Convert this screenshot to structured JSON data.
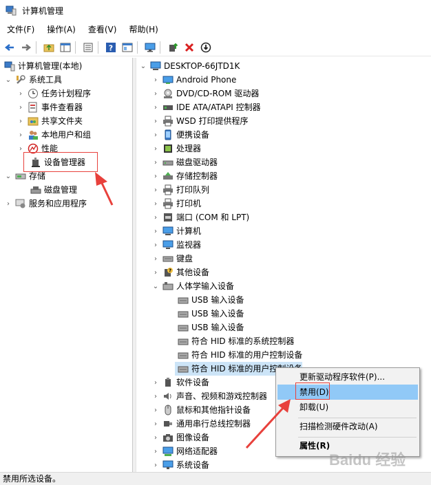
{
  "window": {
    "title": "计算机管理"
  },
  "menubar": [
    "文件(F)",
    "操作(A)",
    "查看(V)",
    "帮助(H)"
  ],
  "toolbar": {
    "icons": [
      "back-arrow-icon",
      "forward-arrow-icon",
      "up-folder-icon",
      "show-hide-tree-icon",
      "export-list-icon",
      "help-icon",
      "properties-icon",
      "monitor-icon",
      "update-driver-icon",
      "uninstall-icon",
      "disable-icon"
    ]
  },
  "left_tree": [
    {
      "label": "计算机管理(本地)"
    },
    {
      "label": "系统工具"
    },
    {
      "label": "任务计划程序"
    },
    {
      "label": "事件查看器"
    },
    {
      "label": "共享文件夹"
    },
    {
      "label": "本地用户和组"
    },
    {
      "label": "性能"
    },
    {
      "label": "设备管理器"
    },
    {
      "label": "存储"
    },
    {
      "label": "磁盘管理"
    },
    {
      "label": "服务和应用程序"
    }
  ],
  "right_tree": [
    {
      "label": "DESKTOP-66JTD1K"
    },
    {
      "label": "Android Phone"
    },
    {
      "label": "DVD/CD-ROM 驱动器"
    },
    {
      "label": "IDE ATA/ATAPI 控制器"
    },
    {
      "label": "WSD 打印提供程序"
    },
    {
      "label": "便携设备"
    },
    {
      "label": "处理器"
    },
    {
      "label": "磁盘驱动器"
    },
    {
      "label": "存储控制器"
    },
    {
      "label": "打印队列"
    },
    {
      "label": "打印机"
    },
    {
      "label": "端口 (COM 和 LPT)"
    },
    {
      "label": "计算机"
    },
    {
      "label": "监视器"
    },
    {
      "label": "键盘"
    },
    {
      "label": "其他设备"
    },
    {
      "label": "人体学输入设备"
    },
    {
      "label": "USB 输入设备"
    },
    {
      "label": "USB 输入设备"
    },
    {
      "label": "USB 输入设备"
    },
    {
      "label": "符合 HID 标准的系统控制器"
    },
    {
      "label": "符合 HID 标准的用户控制设备"
    },
    {
      "label": "符合 HID 标准的用户控制设备"
    },
    {
      "label": "软件设备"
    },
    {
      "label": "声音、视频和游戏控制器"
    },
    {
      "label": "鼠标和其他指针设备"
    },
    {
      "label": "通用串行总线控制器"
    },
    {
      "label": "图像设备"
    },
    {
      "label": "网络适配器"
    },
    {
      "label": "系统设备"
    }
  ],
  "context_menu": {
    "items": [
      "更新驱动程序软件(P)...",
      "禁用(D)",
      "卸载(U)",
      "扫描检测硬件改动(A)",
      "属性(R)"
    ]
  },
  "status": {
    "text": "禁用所选设备。"
  },
  "watermark": {
    "text": "Baidu 经验"
  },
  "colors": {
    "highlight": "#91c9f7",
    "annotation": "#e8413c"
  }
}
